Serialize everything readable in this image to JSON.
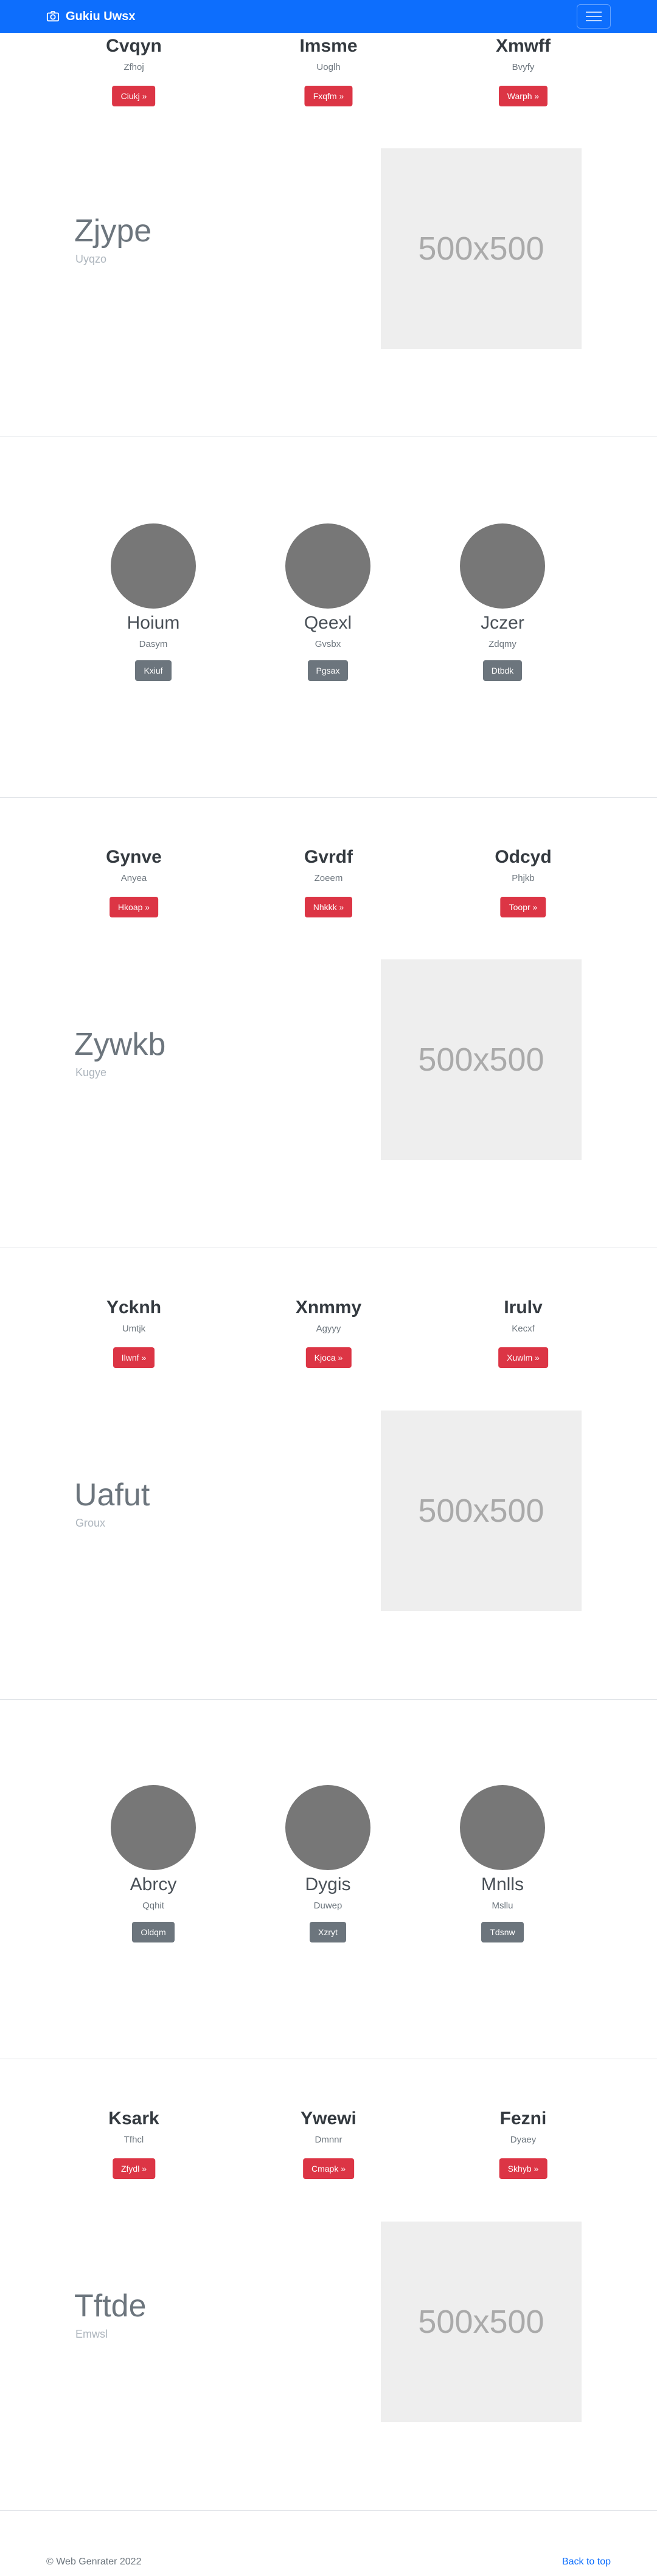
{
  "navbar": {
    "brand": "Gukiu Uwsx",
    "brand_icon": "camera-icon",
    "color": "#0d6efd"
  },
  "sections": [
    {
      "type": "features",
      "columns": [
        {
          "title": "Cvqyn",
          "subtitle": "Zfhoj",
          "button": "Ciukj »"
        },
        {
          "title": "Imsme",
          "subtitle": "Uoglh",
          "button": "Fxqfm »"
        },
        {
          "title": "Xmwff",
          "subtitle": "Bvyfy",
          "button": "Warph »"
        }
      ],
      "feature": {
        "title": "Zjype",
        "subtitle": "Uyqzo",
        "image": "500x500"
      }
    },
    {
      "type": "avatars",
      "people": [
        {
          "name": "Hoium",
          "subtitle": "Dasym",
          "button": "Kxiuf"
        },
        {
          "name": "Qeexl",
          "subtitle": "Gvsbx",
          "button": "Pgsax"
        },
        {
          "name": "Jczer",
          "subtitle": "Zdqmy",
          "button": "Dtbdk"
        }
      ]
    },
    {
      "type": "features",
      "columns": [
        {
          "title": "Gynve",
          "subtitle": "Anyea",
          "button": "Hkoap »"
        },
        {
          "title": "Gvrdf",
          "subtitle": "Zoeem",
          "button": "Nhkkk »"
        },
        {
          "title": "Odcyd",
          "subtitle": "Phjkb",
          "button": "Toopr »"
        }
      ],
      "feature": {
        "title": "Zywkb",
        "subtitle": "Kugye",
        "image": "500x500"
      }
    },
    {
      "type": "features",
      "columns": [
        {
          "title": "Ycknh",
          "subtitle": "Umtjk",
          "button": "Ilwnf »"
        },
        {
          "title": "Xnmmy",
          "subtitle": "Agyyy",
          "button": "Kjoca »"
        },
        {
          "title": "Irulv",
          "subtitle": "Kecxf",
          "button": "Xuwlm »"
        }
      ],
      "feature": {
        "title": "Uafut",
        "subtitle": "Groux",
        "image": "500x500"
      }
    },
    {
      "type": "avatars",
      "people": [
        {
          "name": "Abrcy",
          "subtitle": "Qqhit",
          "button": "Oldqm"
        },
        {
          "name": "Dygis",
          "subtitle": "Duwep",
          "button": "Xzryt"
        },
        {
          "name": "Mnlls",
          "subtitle": "Msllu",
          "button": "Tdsnw"
        }
      ]
    },
    {
      "type": "features",
      "columns": [
        {
          "title": "Ksark",
          "subtitle": "Tfhcl",
          "button": "Zfydl »"
        },
        {
          "title": "Ywewi",
          "subtitle": "Dmnnr",
          "button": "Cmapk »"
        },
        {
          "title": "Fezni",
          "subtitle": "Dyaey",
          "button": "Skhyb »"
        }
      ],
      "feature": {
        "title": "Tftde",
        "subtitle": "Emwsl",
        "image": "500x500"
      }
    }
  ],
  "footer": {
    "copyright": "© Web Genrater 2022",
    "back_to_top": "Back to top"
  }
}
